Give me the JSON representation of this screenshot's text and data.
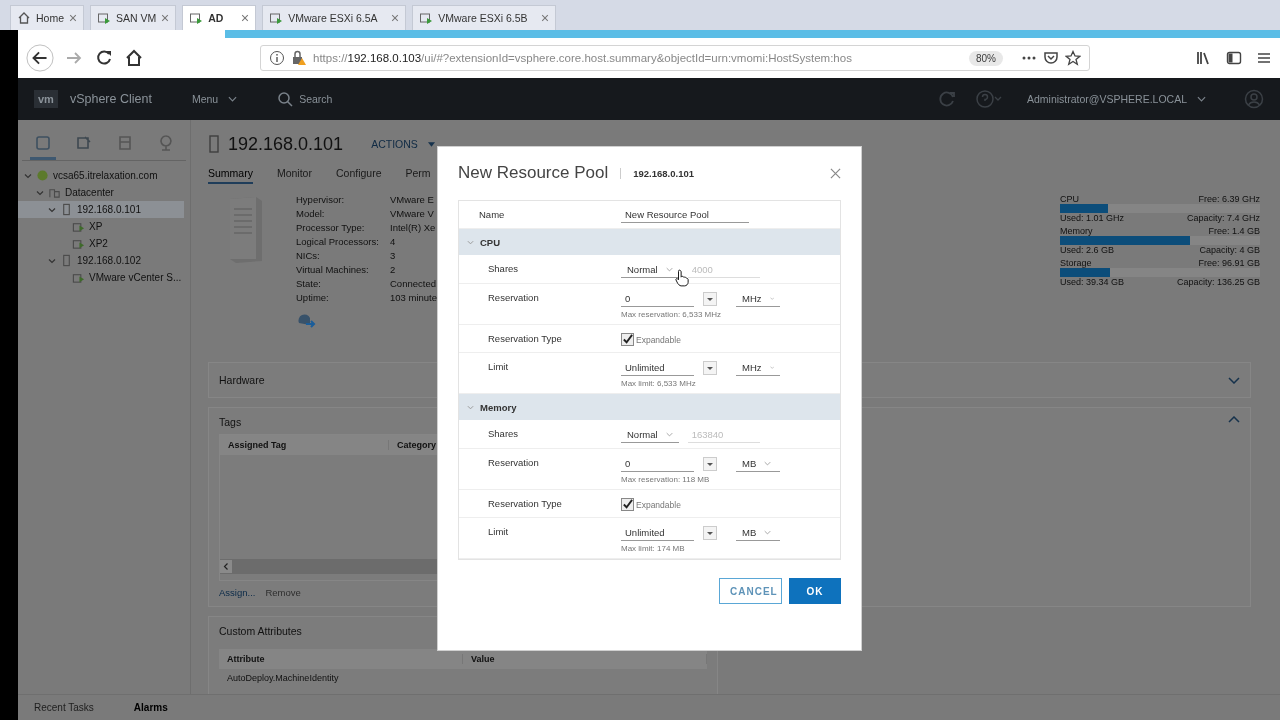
{
  "browser": {
    "tabs": [
      {
        "label": "Home",
        "kind": "home",
        "selected": false
      },
      {
        "label": "SAN VM",
        "kind": "vm",
        "selected": false
      },
      {
        "label": "AD",
        "kind": "vm",
        "selected": true
      },
      {
        "label": "VMware ESXi 6.5A",
        "kind": "vm",
        "selected": false
      },
      {
        "label": "VMware ESXi 6.5B",
        "kind": "vm",
        "selected": false
      }
    ],
    "url": {
      "scheme": "https://",
      "host": "192.168.0.103",
      "path": "/ui/#?extensionId=vsphere.core.host.summary&objectId=urn:vmomi:HostSystem:hos"
    },
    "zoom": "80%"
  },
  "header": {
    "logo": "vm",
    "product": "vSphere Client",
    "menu": "Menu",
    "search_placeholder": "Search",
    "user": "Administrator@VSPHERE.LOCAL"
  },
  "nav": {
    "icon_tabs": [
      {
        "kind": "hosts",
        "selected": true
      },
      {
        "kind": "vms",
        "selected": false
      },
      {
        "kind": "storage",
        "selected": false
      },
      {
        "kind": "network",
        "selected": false
      }
    ],
    "tree": [
      {
        "label": "vcsa65.itrelaxation.com",
        "kind": "vcenter",
        "selected": false,
        "expanded": true,
        "children": [
          {
            "label": "Datacenter",
            "kind": "datacenter",
            "selected": false,
            "expanded": true,
            "children": [
              {
                "label": "192.168.0.101",
                "kind": "host",
                "selected": true,
                "expanded": true,
                "children": [
                  {
                    "label": "XP",
                    "kind": "vm",
                    "selected": false
                  },
                  {
                    "label": "XP2",
                    "kind": "vm",
                    "selected": false
                  }
                ]
              },
              {
                "label": "192.168.0.102",
                "kind": "host",
                "selected": false,
                "expanded": true,
                "children": [
                  {
                    "label": "VMware vCenter S...",
                    "kind": "vm",
                    "selected": false
                  }
                ]
              }
            ]
          }
        ]
      }
    ]
  },
  "object": {
    "title": "192.168.0.101",
    "actions": "ACTIONS",
    "tabs": [
      {
        "label": "Summary",
        "selected": true
      },
      {
        "label": "Monitor",
        "selected": false
      },
      {
        "label": "Configure",
        "selected": false
      },
      {
        "label": "Perm",
        "selected": false
      }
    ],
    "properties": [
      {
        "label": "Hypervisor:",
        "value": "VMware E"
      },
      {
        "label": "Model:",
        "value": "VMware V"
      },
      {
        "label": "Processor Type:",
        "value": "Intel(R) Xe"
      },
      {
        "label": "Logical Processors:",
        "value": "4"
      },
      {
        "label": "NICs:",
        "value": "3"
      },
      {
        "label": "Virtual Machines:",
        "value": "2"
      },
      {
        "label": "State:",
        "value": "Connected"
      },
      {
        "label": "Uptime:",
        "value": "103 minute"
      }
    ],
    "meters": [
      {
        "name": "CPU",
        "free": "Free: 6.39 GHz",
        "used": "Used: 1.01 GHz",
        "capacity": "Capacity: 7.4 GHz",
        "level": 0.24
      },
      {
        "name": "Memory",
        "free": "Free: 1.4 GB",
        "used": "Used: 2.6 GB",
        "capacity": "Capacity: 4 GB",
        "level": 0.65
      },
      {
        "name": "Storage",
        "free": "Free: 96.91 GB",
        "used": "Used: 39.34 GB",
        "capacity": "Capacity: 136.25 GB",
        "level": 0.25
      }
    ],
    "hardware": {
      "title": "Hardware",
      "expanded": false
    },
    "tags": {
      "title": "Tags",
      "expanded": true,
      "columns": [
        "Assigned Tag",
        "Category"
      ],
      "links": [
        {
          "label": "Assign...",
          "disabled": false
        },
        {
          "label": "Remove",
          "disabled": true
        }
      ]
    },
    "custom_attributes": {
      "title": "Custom Attributes",
      "columns": [
        "Attribute",
        "Value"
      ],
      "rows": [
        "AutoDeploy.MachineIdentity"
      ]
    }
  },
  "bottom_tabs": [
    {
      "label": "Recent Tasks",
      "selected": false
    },
    {
      "label": "Alarms",
      "selected": true
    }
  ],
  "dialog": {
    "title": "New Resource Pool",
    "subtitle": "192.168.0.101",
    "name_label": "Name",
    "name_value": "New Resource Pool",
    "sections": [
      {
        "title": "CPU",
        "expanded": true,
        "rows": [
          {
            "kind": "shares",
            "label": "Shares",
            "setting": "Normal",
            "value": "4000"
          },
          {
            "kind": "amount",
            "label": "Reservation",
            "value": "0",
            "unit": "MHz",
            "hint": "Max reservation: 6,533 MHz"
          },
          {
            "kind": "check",
            "label": "Reservation Type",
            "text": "Expandable",
            "checked": true
          },
          {
            "kind": "amount",
            "label": "Limit",
            "value": "Unlimited",
            "unit": "MHz",
            "hint": "Max limit: 6,533 MHz"
          }
        ]
      },
      {
        "title": "Memory",
        "expanded": true,
        "rows": [
          {
            "kind": "shares",
            "label": "Shares",
            "setting": "Normal",
            "value": "163840"
          },
          {
            "kind": "amount",
            "label": "Reservation",
            "value": "0",
            "unit": "MB",
            "hint": "Max reservation: 118 MB"
          },
          {
            "kind": "check",
            "label": "Reservation Type",
            "text": "Expandable",
            "checked": true
          },
          {
            "kind": "amount",
            "label": "Limit",
            "value": "Unlimited",
            "unit": "MB",
            "hint": "Max limit: 174 MB"
          }
        ]
      }
    ],
    "buttons": [
      {
        "label": "CANCEL",
        "kind": "secondary"
      },
      {
        "label": "OK",
        "kind": "primary"
      }
    ]
  }
}
